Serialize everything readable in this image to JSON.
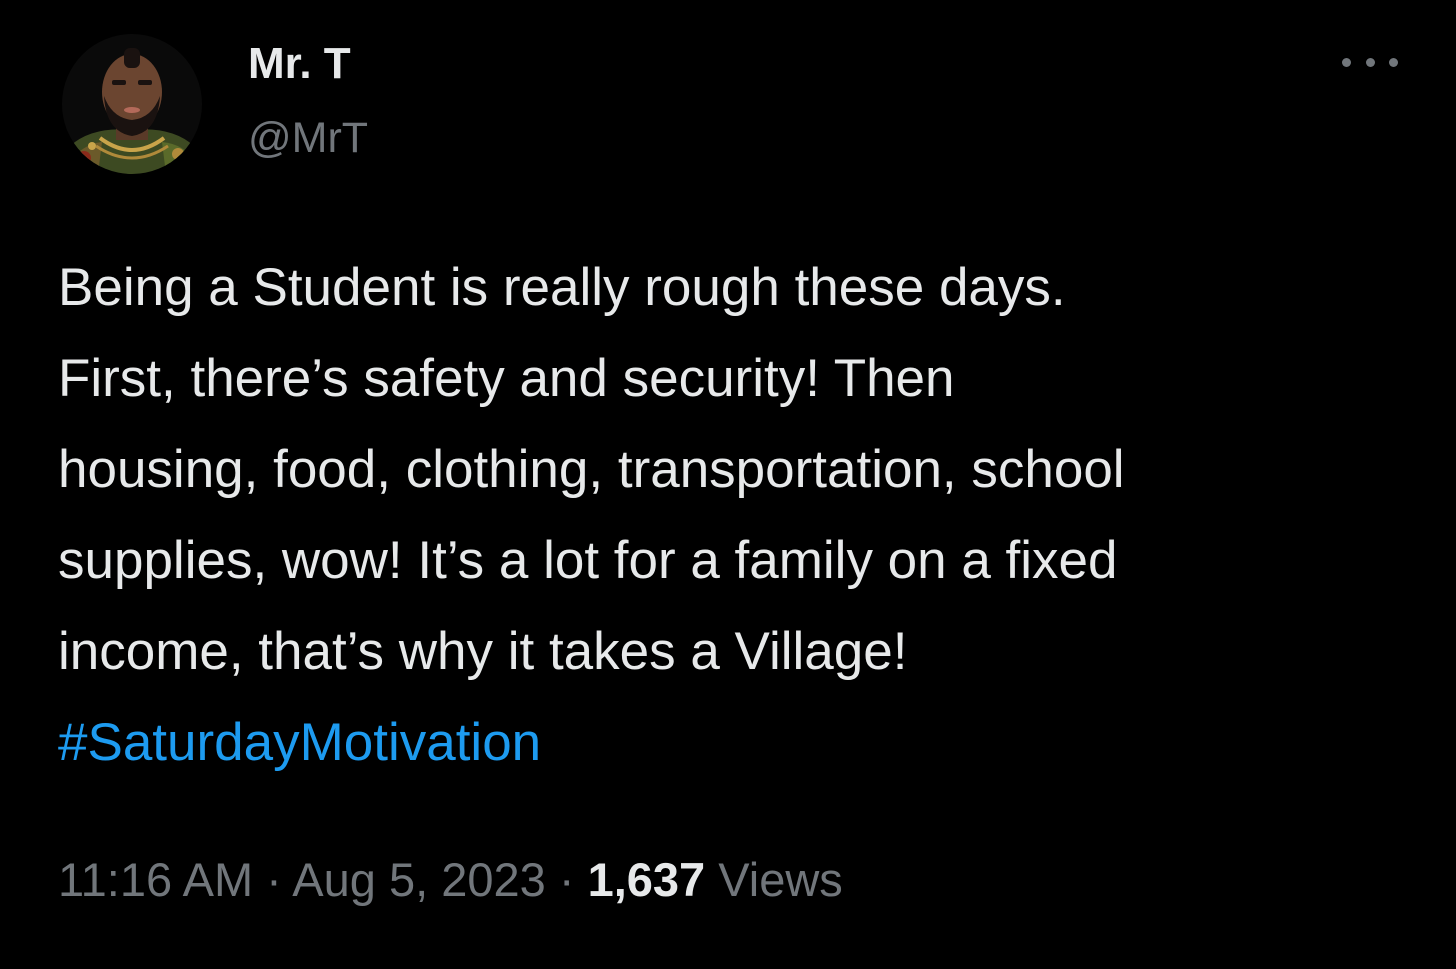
{
  "author": {
    "display_name": "Mr. T",
    "handle": "@MrT"
  },
  "more_icon": "ellipsis-icon",
  "tweet": {
    "lines": [
      "Being a Student is really rough these days.",
      "First, there’s safety and security! Then",
      "housing, food, clothing, transportation, school",
      "supplies, wow! It’s a lot for a family on a fixed",
      "income, that’s why it takes a Village!"
    ],
    "hashtag": "#SaturdayMotivation"
  },
  "meta": {
    "time": "11:16 AM",
    "separator": "·",
    "date": "Aug 5, 2023",
    "views_count": "1,637",
    "views_label": "Views"
  },
  "colors": {
    "background": "#000000",
    "text": "#e7e9ea",
    "secondary": "#71767b",
    "link": "#1d9bf0"
  }
}
